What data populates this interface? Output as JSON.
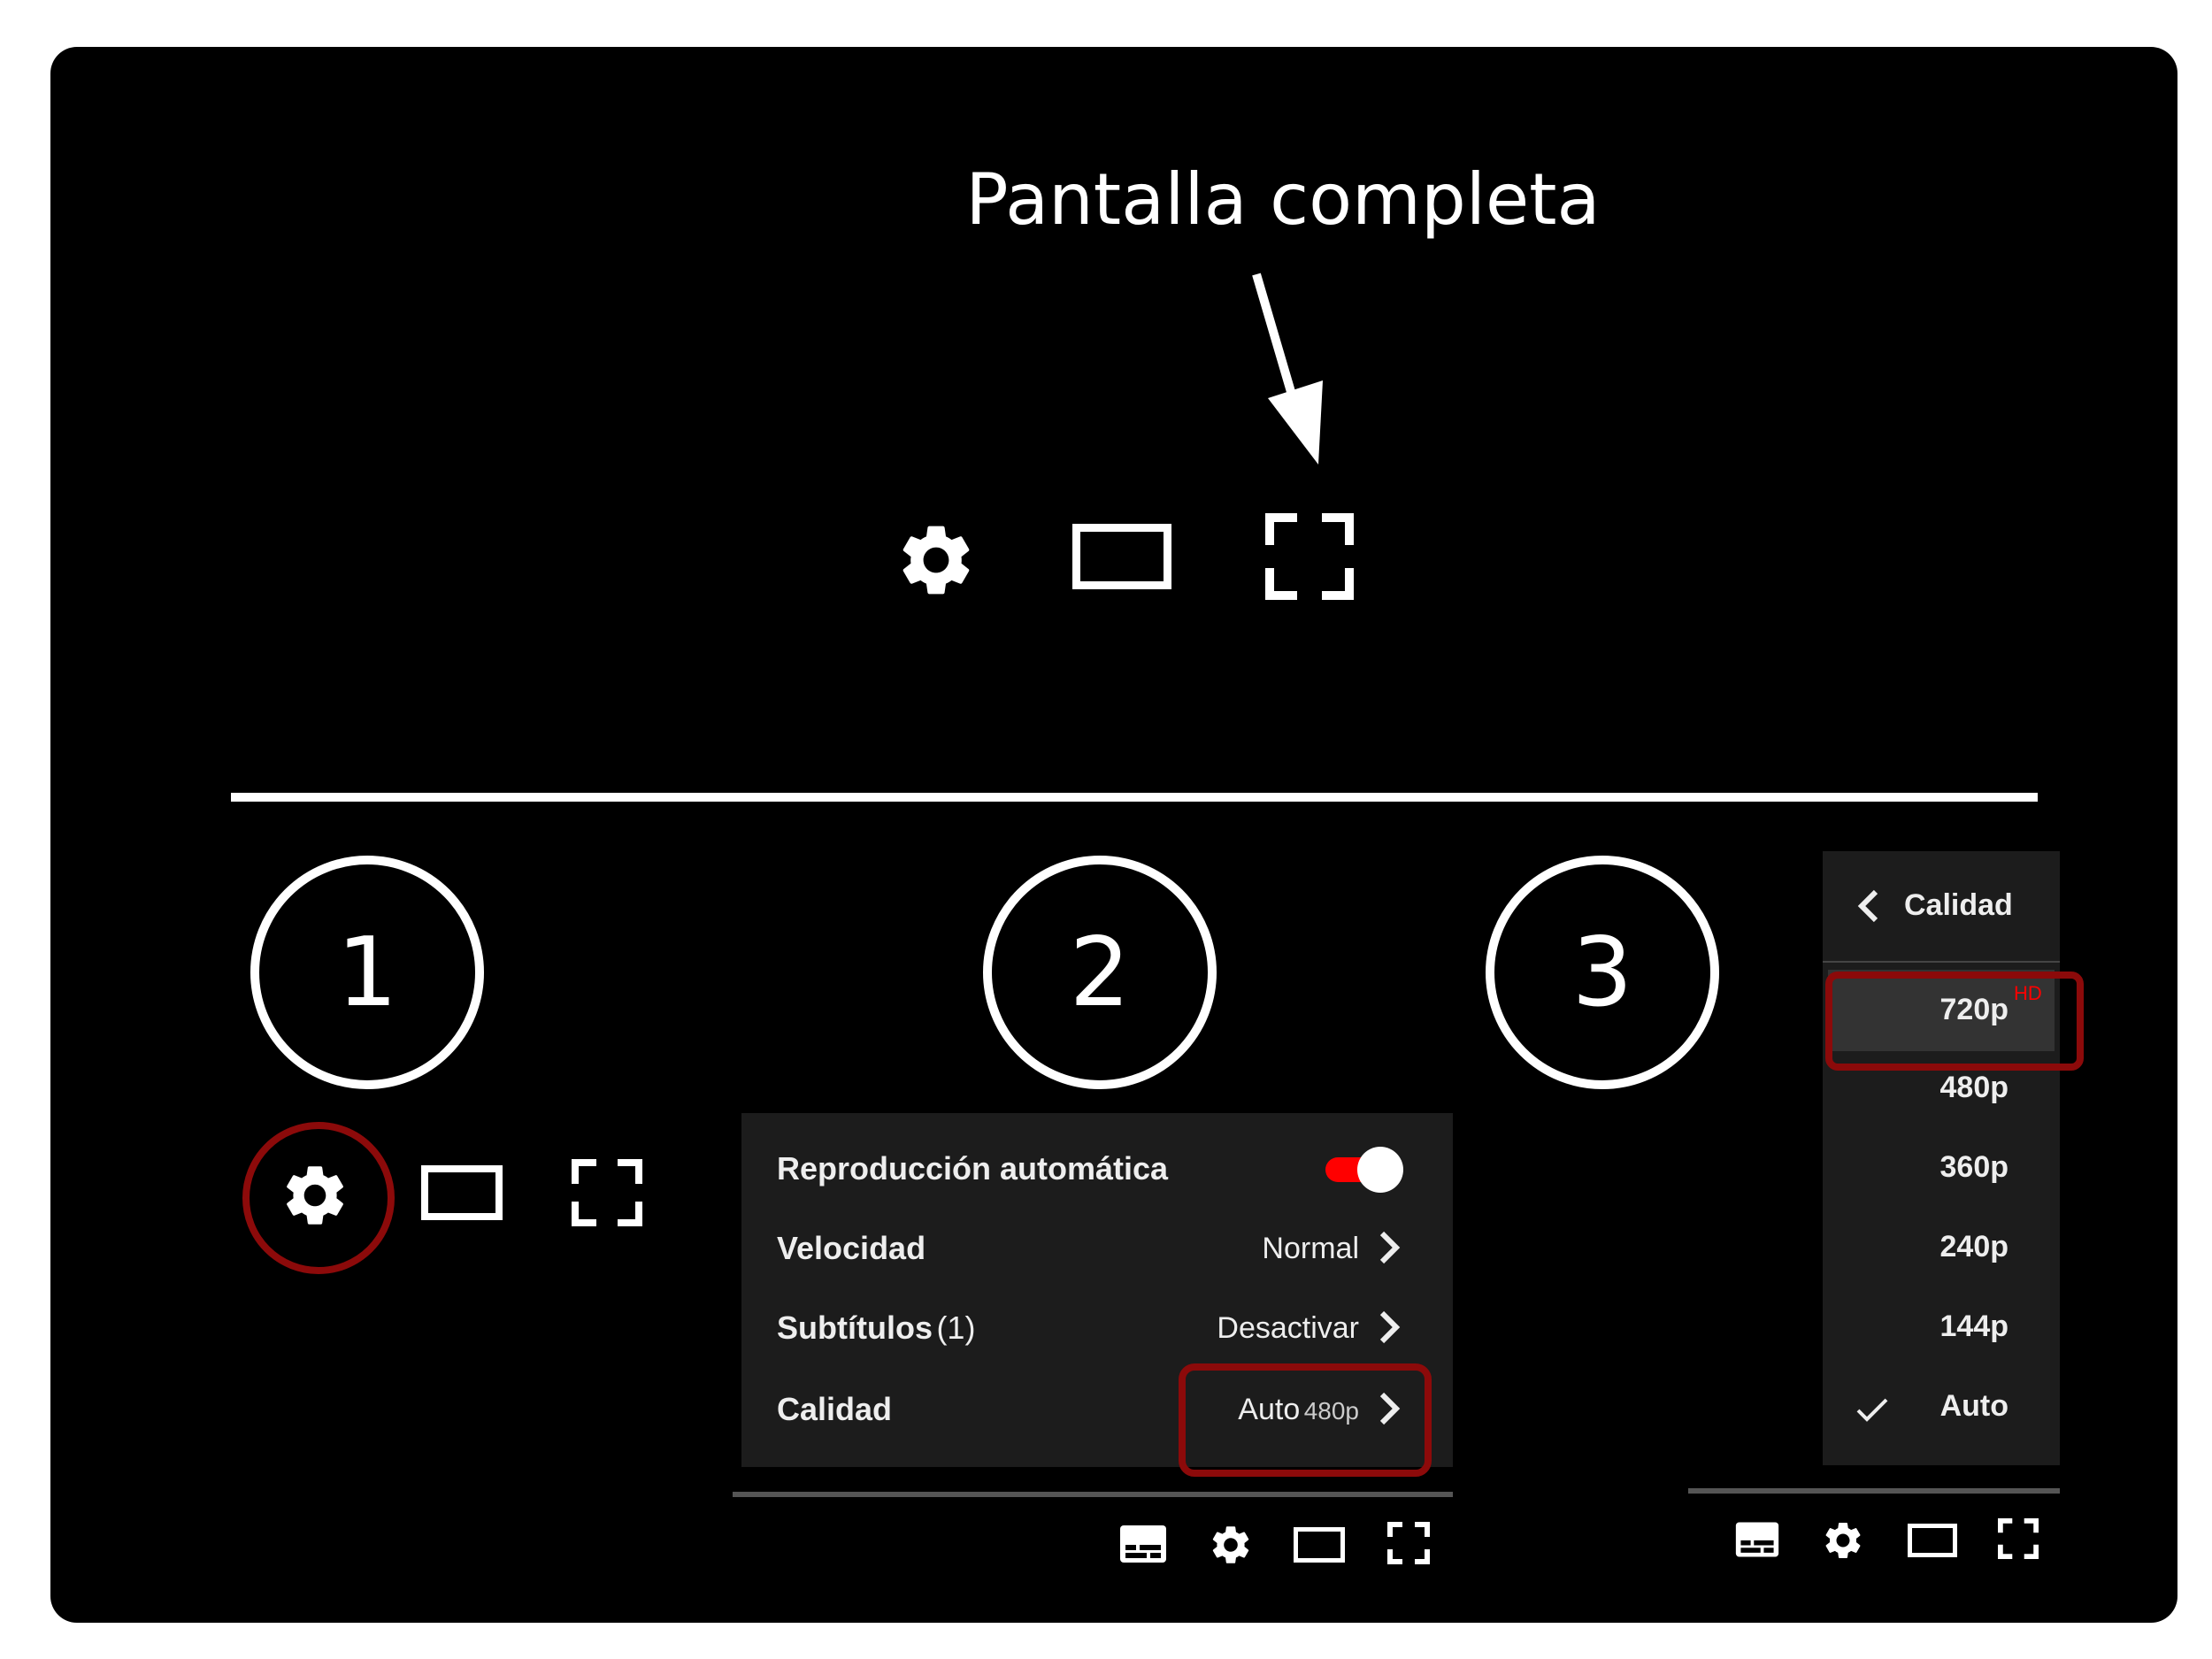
{
  "heading": "Pantalla completa",
  "steps": [
    "1",
    "2",
    "3"
  ],
  "settings_menu": {
    "autoplay_label": "Reproducción automática",
    "autoplay_on": true,
    "speed_label": "Velocidad",
    "speed_value": "Normal",
    "subtitles_label": "Subtítulos",
    "subtitles_count": "(1)",
    "subtitles_value": "Desactivar",
    "quality_label": "Calidad",
    "quality_value": "Auto",
    "quality_sub": "480p"
  },
  "quality_menu": {
    "title": "Calidad",
    "options": [
      "720p",
      "480p",
      "360p",
      "240p",
      "144p",
      "Auto"
    ],
    "hd_badge": "HD",
    "selected": "Auto",
    "highlighted": "720p"
  },
  "icons": [
    "gear-icon",
    "theater-mode-icon",
    "fullscreen-icon",
    "subtitles-icon",
    "arrow-icon",
    "chevron-right-icon",
    "chevron-left-icon",
    "check-icon"
  ],
  "colors": {
    "panel": "#000000",
    "highlight_ring": "#8c0a0a",
    "toggle": "#ff0000",
    "hd_badge": "#ff0000",
    "menu_bg": "#1c1c1c"
  }
}
